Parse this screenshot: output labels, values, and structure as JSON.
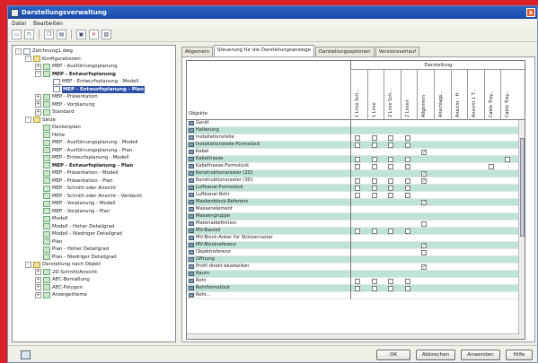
{
  "window": {
    "title": "Darstellungsverwaltung",
    "close_glyph": "x"
  },
  "menu": [
    "Datei",
    "Bearbeiten"
  ],
  "toolbar": [
    "new-icon",
    "open-icon",
    "copy-icon",
    "paste-icon",
    "properties-icon",
    "delete-icon",
    "tree-icon"
  ],
  "tree": [
    {
      "label": "Zeichnung1.dwg",
      "indent": 0,
      "toggle": "-",
      "icon": "file"
    },
    {
      "label": "Konfigurationen",
      "indent": 1,
      "toggle": "-",
      "icon": "folder"
    },
    {
      "label": "MEP - Ausführungsplanung",
      "indent": 2,
      "toggle": "+",
      "icon": "node"
    },
    {
      "label": "MEP - Entwurfsplanung",
      "indent": 2,
      "toggle": "-",
      "icon": "node",
      "bold": true
    },
    {
      "label": "MEP - Entwurfsplanung - Modell",
      "indent": 3,
      "toggle": "",
      "icon": "file"
    },
    {
      "label": "MEP - Entwurfsplanung - Plan",
      "indent": 3,
      "toggle": "",
      "icon": "file",
      "bold": true,
      "selected": true
    },
    {
      "label": "MEP - Präsentation",
      "indent": 2,
      "toggle": "+",
      "icon": "node"
    },
    {
      "label": "MEP - Vorplanung",
      "indent": 2,
      "toggle": "+",
      "icon": "node"
    },
    {
      "label": "Standard",
      "indent": 2,
      "toggle": "+",
      "icon": "node"
    },
    {
      "label": "Sätze",
      "indent": 1,
      "toggle": "-",
      "icon": "folder"
    },
    {
      "label": "Deckenplan",
      "indent": 2,
      "toggle": "",
      "icon": "node"
    },
    {
      "label": "Höhe",
      "indent": 2,
      "toggle": "",
      "icon": "node"
    },
    {
      "label": "MEP - Ausführungsplanung - Modell",
      "indent": 2,
      "toggle": "",
      "icon": "node"
    },
    {
      "label": "MEP - Ausführungsplanung - Plan",
      "indent": 2,
      "toggle": "",
      "icon": "node"
    },
    {
      "label": "MEP - Entwurfsplanung - Modell",
      "indent": 2,
      "toggle": "",
      "icon": "node"
    },
    {
      "label": "MEP - Entwurfsplanung - Plan",
      "indent": 2,
      "toggle": "",
      "icon": "node",
      "bold": true
    },
    {
      "label": "MEP - Präsentation - Modell",
      "indent": 2,
      "toggle": "",
      "icon": "node"
    },
    {
      "label": "MEP - Präsentation - Plan",
      "indent": 2,
      "toggle": "",
      "icon": "node"
    },
    {
      "label": "MEP - Schnitt oder Ansicht",
      "indent": 2,
      "toggle": "",
      "icon": "node"
    },
    {
      "label": "MEP - Schnitt oder Ansicht - Verdeckt",
      "indent": 2,
      "toggle": "",
      "icon": "node"
    },
    {
      "label": "MEP - Vorplanung - Modell",
      "indent": 2,
      "toggle": "",
      "icon": "node"
    },
    {
      "label": "MEP - Vorplanung - Plan",
      "indent": 2,
      "toggle": "",
      "icon": "node"
    },
    {
      "label": "Modell",
      "indent": 2,
      "toggle": "",
      "icon": "node"
    },
    {
      "label": "Modell - Hoher Detailgrad",
      "indent": 2,
      "toggle": "",
      "icon": "node"
    },
    {
      "label": "Modell - Niedriger Detailgrad",
      "indent": 2,
      "toggle": "",
      "icon": "node"
    },
    {
      "label": "Plan",
      "indent": 2,
      "toggle": "",
      "icon": "node"
    },
    {
      "label": "Plan - Hoher Detailgrad",
      "indent": 2,
      "toggle": "",
      "icon": "node"
    },
    {
      "label": "Plan - Niedriger Detailgrad",
      "indent": 2,
      "toggle": "",
      "icon": "node"
    },
    {
      "label": "Darstellung nach Objekt",
      "indent": 1,
      "toggle": "-",
      "icon": "folder"
    },
    {
      "label": "2D-Schnitt/Ansicht",
      "indent": 2,
      "toggle": "+",
      "icon": "node"
    },
    {
      "label": "AEC-Bemaßung",
      "indent": 2,
      "toggle": "+",
      "icon": "node"
    },
    {
      "label": "AEC-Polygon",
      "indent": 2,
      "toggle": "+",
      "icon": "node"
    },
    {
      "label": "Anzeigetheme",
      "indent": 2,
      "toggle": "+",
      "icon": "node"
    }
  ],
  "tabs": [
    "Allgemein",
    "Steuerung für die Darstellungsanzeige",
    "Darstellungsoptionen",
    "Versionsverlauf"
  ],
  "active_tab": 1,
  "grid": {
    "object_header": "Objekte",
    "group_header": "Darstellung",
    "columns": [
      "1 Linie Sch...",
      "1 Linie",
      "2 Linie Sch...",
      "2 Linien",
      "Allgemein",
      "Anschlags...",
      "Ansicht - H",
      "Ansicht 1 T...",
      "Cable Tray...",
      "Cable Tray..."
    ],
    "rows": [
      {
        "name": "Gerät",
        "checks": []
      },
      {
        "name": "Halterung",
        "checks": []
      },
      {
        "name": "Installationsteile",
        "checks": [
          "u",
          "u",
          "u",
          "u"
        ]
      },
      {
        "name": "Installationsteile-Formstück",
        "checks": [
          "u",
          "u",
          "u",
          "u"
        ]
      },
      {
        "name": "Kabel",
        "checks": [
          "",
          "",
          "",
          "",
          "c"
        ]
      },
      {
        "name": "Kabeltrasse",
        "checks": [
          "u",
          "u",
          "u",
          "u",
          "",
          "",
          "",
          "",
          "",
          "u"
        ]
      },
      {
        "name": "Kabeltrasse-Formstück",
        "checks": [
          "u",
          "u",
          "u",
          "u",
          "",
          "",
          "",
          "",
          "u"
        ]
      },
      {
        "name": "Konstruktionsraster (2D)",
        "checks": [
          "",
          "",
          "",
          "",
          "c"
        ]
      },
      {
        "name": "Konstruktionsraster (3D)",
        "checks": [
          "u",
          "u",
          "u",
          "u",
          "c"
        ]
      },
      {
        "name": "Luftkanal-Formstück",
        "checks": [
          "u",
          "u",
          "u",
          "u"
        ]
      },
      {
        "name": "Luftkanal-Rohr",
        "checks": [
          "u",
          "u",
          "u",
          "u"
        ]
      },
      {
        "name": "Maskenblock-Referenz",
        "checks": [
          "",
          "",
          "",
          "",
          "c"
        ]
      },
      {
        "name": "Massenelement",
        "checks": []
      },
      {
        "name": "Massengruppe",
        "checks": []
      },
      {
        "name": "Materialdefinition",
        "checks": [
          "",
          "",
          "",
          "",
          "u"
        ]
      },
      {
        "name": "MV-Bauteil",
        "checks": [
          "u",
          "u",
          "u",
          "u"
        ]
      },
      {
        "name": "MV-Block-Anker für Stützenraster",
        "checks": []
      },
      {
        "name": "MV-Blockreferenz",
        "checks": [
          "",
          "",
          "",
          "",
          "c"
        ]
      },
      {
        "name": "Objektreferenz",
        "checks": [
          "",
          "",
          "",
          "",
          "u"
        ]
      },
      {
        "name": "Öffnung",
        "checks": []
      },
      {
        "name": "Profil direkt bearbeiten",
        "checks": [
          "",
          "",
          "",
          "",
          "c"
        ]
      },
      {
        "name": "Raum",
        "checks": []
      },
      {
        "name": "Rohr",
        "checks": [
          "u",
          "u",
          "u",
          "u"
        ]
      },
      {
        "name": "Rohrformstück",
        "checks": [
          "u",
          "u",
          "u",
          "u"
        ]
      },
      {
        "name": "Rohr...",
        "checks": []
      }
    ]
  },
  "buttons": {
    "ok": "OK",
    "cancel": "Abbrechen",
    "apply": "Anwenden",
    "help": "Hilfe"
  },
  "colors": {
    "accent": "#2b64c8",
    "row_alt": "#bfe3d4",
    "frame": "#d8212a"
  }
}
